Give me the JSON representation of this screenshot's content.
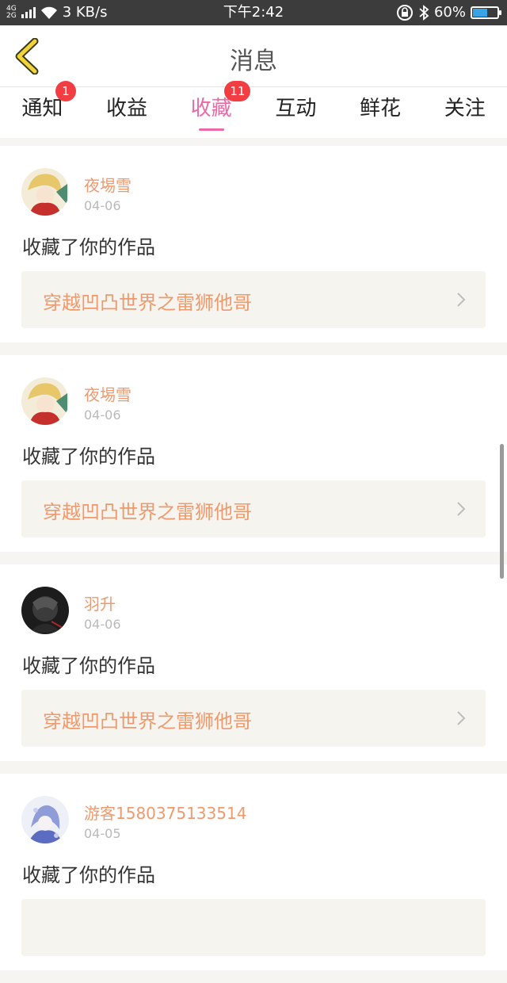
{
  "status_bar": {
    "network_top": "4G",
    "network_bottom": "2G",
    "speed": "3 KB/s",
    "time": "下午2:42",
    "battery_percent": "60%",
    "battery_level": 0.6
  },
  "header": {
    "title": "消息"
  },
  "tabs": [
    {
      "label": "通知",
      "badge": "1"
    },
    {
      "label": "收益",
      "badge": ""
    },
    {
      "label": "收藏",
      "badge": "11",
      "active": true
    },
    {
      "label": "互动",
      "badge": ""
    },
    {
      "label": "鲜花",
      "badge": ""
    },
    {
      "label": "关注",
      "badge": ""
    }
  ],
  "messages": [
    {
      "user": "夜埸雪",
      "date": "04-06",
      "action": "收藏了你的作品",
      "work_title": "穿越凹凸世界之雷狮他哥"
    },
    {
      "user": "夜埸雪",
      "date": "04-06",
      "action": "收藏了你的作品",
      "work_title": "穿越凹凸世界之雷狮他哥"
    },
    {
      "user": "羽升",
      "date": "04-06",
      "action": "收藏了你的作品",
      "work_title": "穿越凹凸世界之雷狮他哥"
    },
    {
      "user": "游客1580375133514",
      "date": "04-05",
      "action": "收藏了你的作品",
      "work_title": ""
    }
  ],
  "colors": {
    "accent": "#ea6aa6",
    "badge": "#f23d43",
    "username": "#ef9a6e",
    "back_arrow": "#f2d43a"
  }
}
